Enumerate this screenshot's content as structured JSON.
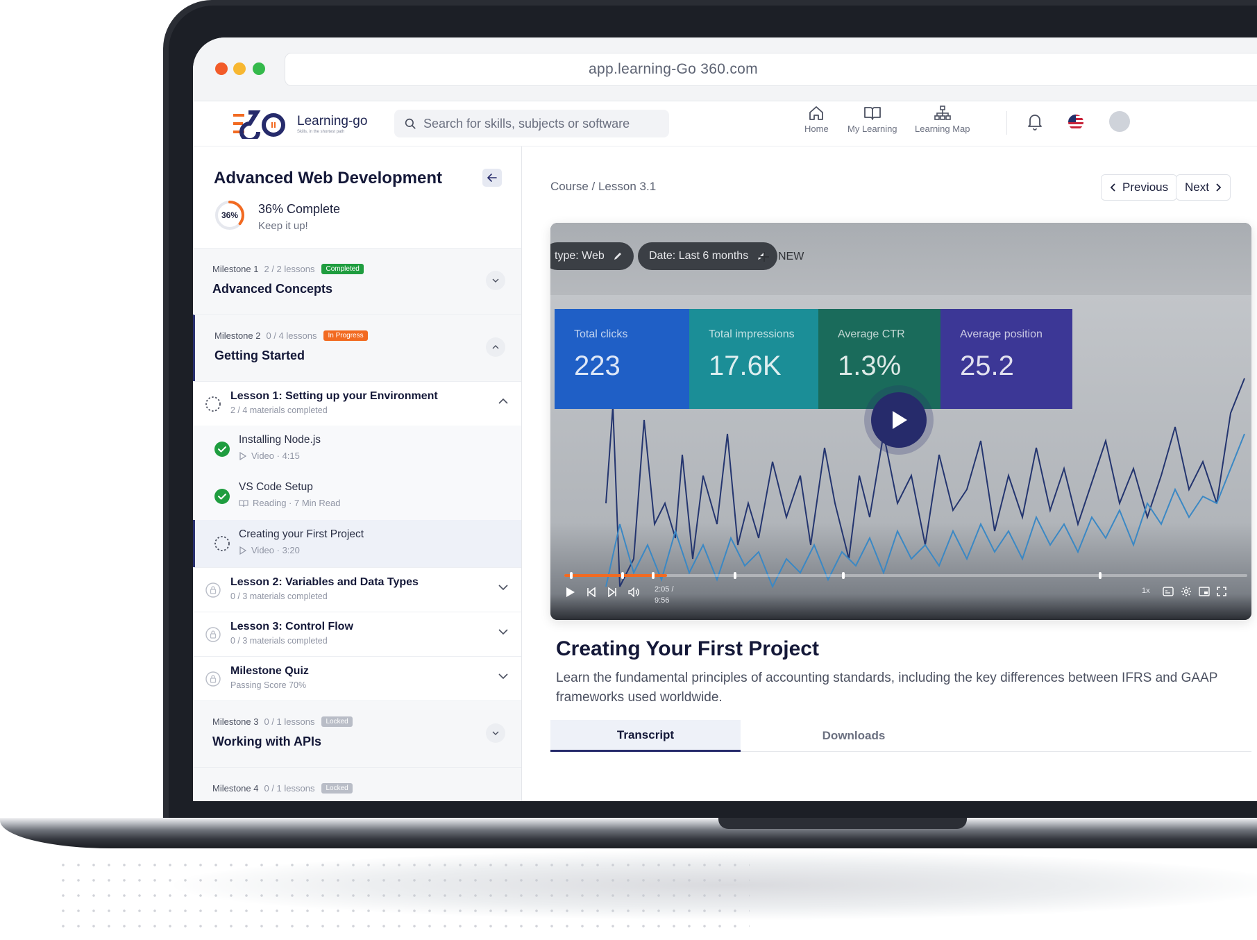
{
  "browser": {
    "url": "app.learning-Go 360.com"
  },
  "header": {
    "brand_name": "Learning-go",
    "brand_tagline": "Skills, in the shortest path",
    "search_placeholder": "Search for skills, subjects or software",
    "nav": [
      {
        "label": "Home",
        "icon": "home-icon"
      },
      {
        "label": "My Learning",
        "icon": "book-icon"
      },
      {
        "label": "Learning Map",
        "icon": "sitemap-icon"
      }
    ]
  },
  "sidebar": {
    "course_title": "Advanced Web Development",
    "progress": {
      "percent_label": "36%",
      "value": 0.36,
      "label": "36% Complete",
      "sub": "Keep it up!"
    },
    "milestones": [
      {
        "meta": "Milestone 1",
        "count": "2 / 2 lessons",
        "badge": "Completed",
        "badge_color": "#1f9d3f",
        "title": "Advanced Concepts"
      },
      {
        "meta": "Milestone 2",
        "count": "0 / 4 lessons",
        "badge": "In Progress",
        "badge_color": "#f26a21",
        "title": "Getting Started"
      },
      {
        "meta": "Milestone 3",
        "count": "0 / 1 lessons",
        "badge": "Locked",
        "badge_color": "#b9bdc7",
        "title": "Working with APIs"
      },
      {
        "meta": "Milestone 4",
        "count": "0 / 1 lessons",
        "badge": "Locked",
        "badge_color": "#b9bdc7",
        "title": ""
      }
    ],
    "lessons": [
      {
        "title": "Lesson 1: Setting up your Environment",
        "sub": "2 / 4 materials completed"
      },
      {
        "title": "Lesson 2: Variables and Data Types",
        "sub": "0 / 3 materials completed"
      },
      {
        "title": "Lesson 3: Control Flow",
        "sub": "0 / 3 materials completed"
      },
      {
        "title": "Milestone Quiz",
        "sub": "Passing Score 70%"
      }
    ],
    "materials": [
      {
        "title": "Installing Node.js",
        "sub": "Video · 4:15",
        "status": "completed"
      },
      {
        "title": "VS Code Setup",
        "sub": "Reading · 7 Min Read",
        "status": "completed"
      },
      {
        "title": "Creating your First Project",
        "sub": "Video · 3:20",
        "status": "current"
      }
    ]
  },
  "main": {
    "breadcrumb": "Course / Lesson 3.1",
    "previous_label": "Previous",
    "next_label": "Next",
    "video": {
      "chip_type": "type: Web",
      "chip_date": "Date: Last 6 months",
      "new_label": "NEW",
      "kpis": [
        {
          "label": "Total clicks",
          "value": "223",
          "color": "#1f5fc6"
        },
        {
          "label": "Total impressions",
          "value": "17.6K",
          "color": "#1b8e97"
        },
        {
          "label": "Average CTR",
          "value": "1.3%",
          "color": "#1a6b5b"
        },
        {
          "label": "Average position",
          "value": "25.2",
          "color": "#3c3796"
        }
      ],
      "time_current": "2:05 /",
      "time_total": "9:56",
      "played_fraction": 0.15,
      "speed": "1x"
    },
    "lesson_title": "Creating Your First Project",
    "lesson_description": "Learn the fundamental principles of accounting standards, including the key differences between IFRS and GAAP frameworks used worldwide.",
    "tabs": [
      {
        "label": "Transcript",
        "active": true
      },
      {
        "label": "Downloads",
        "active": false
      }
    ]
  },
  "colors": {
    "brand_navy": "#262b6b",
    "accent_orange": "#f26a21",
    "success_green": "#1f9d3f"
  }
}
